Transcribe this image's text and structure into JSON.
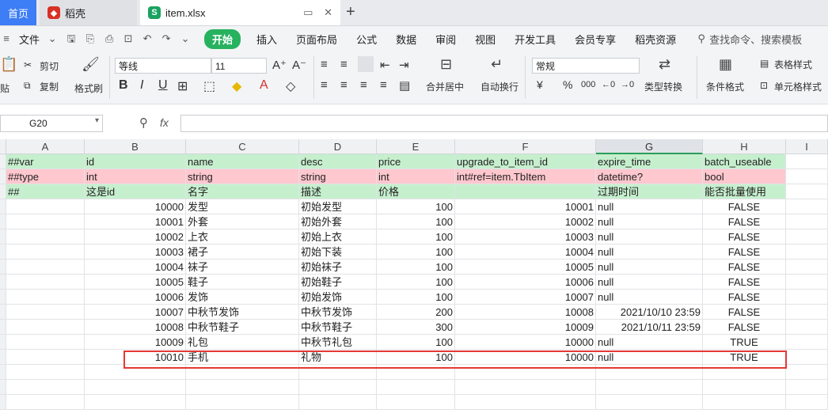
{
  "tabs": {
    "home": "首页",
    "daoke": "稻壳",
    "file": "item.xlsx",
    "add": "+"
  },
  "menu": {
    "file": "文件",
    "items": [
      "开始",
      "插入",
      "页面布局",
      "公式",
      "数据",
      "审阅",
      "视图",
      "开发工具",
      "会员专享",
      "稻壳资源"
    ],
    "search": "查找命令、搜索模板"
  },
  "ribbon": {
    "cut": "剪切",
    "paste": "贴",
    "copy": "复制",
    "format_painter": "格式刷",
    "font_name": "等线",
    "font_size": "11",
    "merge": "合并居中",
    "wrap": "自动换行",
    "number_format": "常规",
    "type_convert": "类型转换",
    "cond_format": "条件格式",
    "table_style": "表格样式",
    "cell_style": "单元格样式"
  },
  "formula_bar": {
    "cell_ref": "G20",
    "fx": "fx",
    "value": ""
  },
  "columns": [
    "A",
    "B",
    "C",
    "D",
    "E",
    "F",
    "G",
    "H",
    "I"
  ],
  "rows": [
    [
      "##var",
      "id",
      "name",
      "desc",
      "price",
      "upgrade_to_item_id",
      "expire_time",
      "batch_useable"
    ],
    [
      "##type",
      "int",
      "string",
      "string",
      "int",
      "int#ref=item.TbItem",
      "datetime?",
      "bool"
    ],
    [
      "##",
      "这是id",
      "名字",
      "描述",
      "价格",
      "",
      "过期时间",
      "能否批量使用"
    ],
    [
      "",
      "10000",
      "发型",
      "初始发型",
      "100",
      "10001",
      "null",
      "FALSE"
    ],
    [
      "",
      "10001",
      "外套",
      "初始外套",
      "100",
      "10002",
      "null",
      "FALSE"
    ],
    [
      "",
      "10002",
      "上衣",
      "初始上衣",
      "100",
      "10003",
      "null",
      "FALSE"
    ],
    [
      "",
      "10003",
      "裙子",
      "初始下装",
      "100",
      "10004",
      "null",
      "FALSE"
    ],
    [
      "",
      "10004",
      "袜子",
      "初始袜子",
      "100",
      "10005",
      "null",
      "FALSE"
    ],
    [
      "",
      "10005",
      "鞋子",
      "初始鞋子",
      "100",
      "10006",
      "null",
      "FALSE"
    ],
    [
      "",
      "10006",
      "发饰",
      "初始发饰",
      "100",
      "10007",
      "null",
      "FALSE"
    ],
    [
      "",
      "10007",
      "中秋节发饰",
      "中秋节发饰",
      "200",
      "10008",
      "2021/10/10 23:59",
      "FALSE"
    ],
    [
      "",
      "10008",
      "中秋节鞋子",
      "中秋节鞋子",
      "300",
      "10009",
      "2021/10/11 23:59",
      "FALSE"
    ],
    [
      "",
      "10009",
      "礼包",
      "中秋节礼包",
      "100",
      "10000",
      "null",
      "TRUE"
    ],
    [
      "",
      "10010",
      "手机",
      "礼物",
      "100",
      "10000",
      "null",
      "TRUE"
    ],
    [
      "",
      "",
      "",
      "",
      "",
      "",
      "",
      ""
    ],
    [
      "",
      "",
      "",
      "",
      "",
      "",
      "",
      ""
    ],
    [
      "",
      "",
      "",
      "",
      "",
      "",
      "",
      ""
    ]
  ]
}
